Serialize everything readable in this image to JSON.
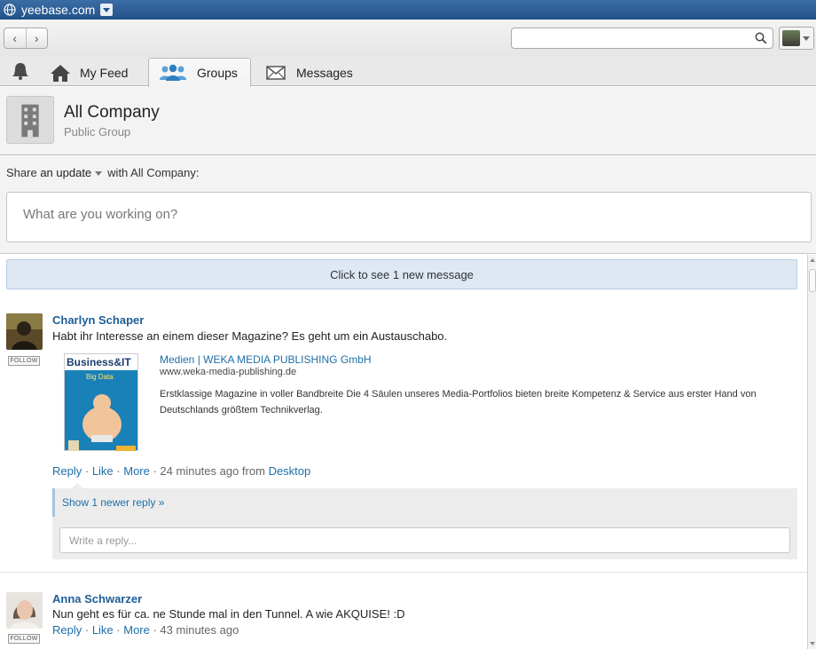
{
  "window": {
    "title": "yeebase.com"
  },
  "toolbar": {
    "back": "‹",
    "forward": "›",
    "search_placeholder": ""
  },
  "tabs": [
    {
      "label": "My Feed",
      "icon": "home-icon"
    },
    {
      "label": "Groups",
      "icon": "groups-icon",
      "active": true
    },
    {
      "label": "Messages",
      "icon": "envelope-icon"
    }
  ],
  "group": {
    "name": "All Company",
    "type": "Public Group"
  },
  "share": {
    "prefix": "Share",
    "type": "an update",
    "suffix": "with All Company:",
    "placeholder": "What are you working on?"
  },
  "feed": {
    "new_message_banner": "Click to see 1 new message",
    "posts": [
      {
        "author": "Charlyn Schaper",
        "follow": "FOLLOW",
        "text": "Habt ihr Interesse an einem dieser Magazine? Es geht um ein Austauschabo.",
        "attachment": {
          "thumb_title": "Business&IT",
          "thumb_sub": "Big Data",
          "title": "Medien | WEKA MEDIA PUBLISHING GmbH",
          "url": "www.weka-media-publishing.de",
          "description": "Erstklassige Magazine in voller Bandbreite Die 4 Säulen unseres Media-Portfolios bieten breite Kompetenz & Service aus erster Hand von Deutschlands größtem Technikverlag."
        },
        "actions": {
          "reply": "Reply",
          "like": "Like",
          "more": "More",
          "time": "24 minutes ago from",
          "source": "Desktop"
        },
        "show_newer": "Show 1 newer reply »",
        "reply_placeholder": "Write a reply..."
      },
      {
        "author": "Anna Schwarzer",
        "follow": "FOLLOW",
        "text": "Nun geht es für ca. ne Stunde mal in den Tunnel. A wie AKQUISE! :D",
        "actions": {
          "reply": "Reply",
          "like": "Like",
          "more": "More",
          "time": "43 minutes ago"
        }
      }
    ]
  },
  "colors": {
    "link": "#1d6fa8",
    "titlebar": "#2d5f97",
    "banner": "#dde8f3"
  }
}
